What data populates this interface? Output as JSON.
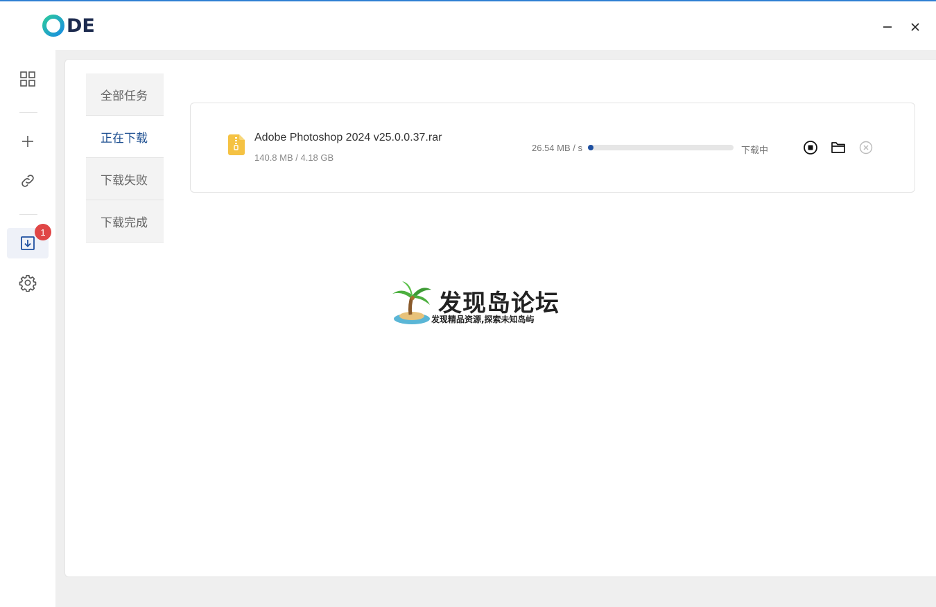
{
  "app": {
    "logo_text": "DE",
    "accent_color": "#1d4fa0",
    "badge_color": "#e04646"
  },
  "window_controls": {
    "minimize_icon": "minimize-icon",
    "close_icon": "close-icon"
  },
  "sidebar": {
    "items": [
      {
        "icon": "grid-icon"
      },
      {
        "icon": "plus-icon"
      },
      {
        "icon": "link-icon"
      },
      {
        "icon": "download-icon",
        "badge": "1",
        "active": true
      },
      {
        "icon": "gear-icon"
      }
    ]
  },
  "tabs": [
    {
      "label": "全部任务"
    },
    {
      "label": "正在下载",
      "active": true
    },
    {
      "label": "下载失败"
    },
    {
      "label": "下载完成"
    }
  ],
  "task": {
    "file_name": "Adobe Photoshop 2024 v25.0.0.37.rar",
    "size": "140.8 MB / 4.18 GB",
    "speed": "26.54 MB / s",
    "progress": 0.034,
    "status": "下载中",
    "file_icon": "archive-file-icon"
  },
  "watermark": {
    "title": "发现岛论坛",
    "subtitle": "发现精品资源,探索未知岛屿"
  }
}
